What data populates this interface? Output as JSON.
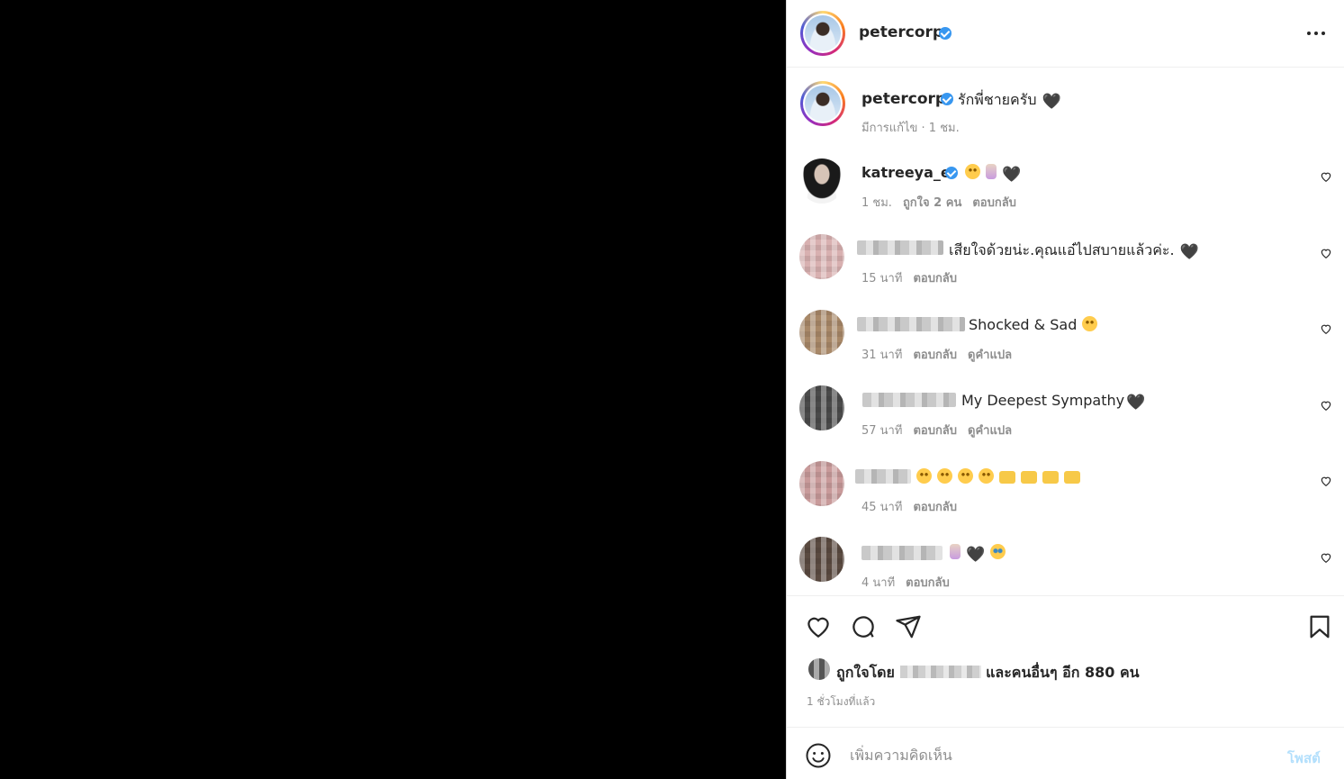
{
  "post": {
    "username": "petercorp",
    "caption": "รักพี่ชายครับ",
    "caption_emoji": "🖤",
    "edited_label": "มีการแก้ไข · 1 ชม."
  },
  "comments": [
    {
      "username": "katreeya_e",
      "text": "",
      "time": "1 ชม.",
      "likes": "ถูกใจ 2 คน",
      "reply": "ตอบกลับ"
    },
    {
      "username": "",
      "text": "เสียใจด้วยน่ะ.คุณแอ๋ไปสบายแล้วค่ะ.",
      "time": "15 นาที",
      "reply": "ตอบกลับ"
    },
    {
      "username": "",
      "text": "Shocked & Sad",
      "time": "31 นาที",
      "reply": "ตอบกลับ",
      "translate": "ดูคำแปล"
    },
    {
      "username": "",
      "text": "My Deepest Sympathy",
      "time": "57 นาที",
      "reply": "ตอบกลับ",
      "translate": "ดูคำแปล"
    },
    {
      "username": "",
      "text": "",
      "time": "45 นาที",
      "reply": "ตอบกลับ"
    },
    {
      "username": "",
      "text": "",
      "time": "4 นาที",
      "reply": "ตอบกลับ"
    }
  ],
  "likes": {
    "prefix": "ถูกใจโดย",
    "suffix": "และคนอื่นๆ อีก 880 คน"
  },
  "time_ago": "1 ชั่วโมงที่แล้ว",
  "comment_input": {
    "placeholder": "เพิ่มความคิดเห็น",
    "post_label": "โพสต์"
  },
  "icons": [
    "more-icon",
    "verified-icon",
    "heart-icon",
    "comment-icon",
    "share-icon",
    "bookmark-icon",
    "emoji-icon"
  ],
  "colors": {
    "link_disabled": "#b2dffc",
    "verified": "#3897f0",
    "meta": "#8e8e8e"
  }
}
